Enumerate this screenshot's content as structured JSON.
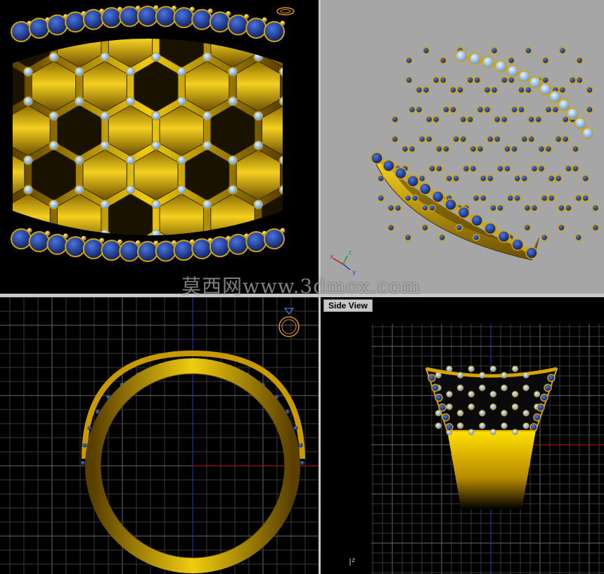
{
  "viewports": {
    "front": {
      "label": ""
    },
    "perspective": {
      "label": ""
    },
    "top": {
      "label": ""
    },
    "side": {
      "label": "Side View"
    }
  },
  "watermark": "莫西网www.3dmox.com",
  "axes": {
    "x": "x",
    "y": "y",
    "z": "z"
  },
  "colors": {
    "viewport_bg": "#000000",
    "perspective_bg": "#a6a6a6",
    "grid_minor": "#3a3a3a",
    "grid_major": "#6a6a6a",
    "axis_x": "#c81414",
    "axis_y": "#1e3cc8",
    "gold": "#d4a400",
    "gold_dark": "#6a4d00",
    "sapphire": "#1a3a9a",
    "light_stone": "#9ec4f0"
  },
  "icons": [
    "ring-gizmo-icon",
    "axis-tripod-icon"
  ]
}
